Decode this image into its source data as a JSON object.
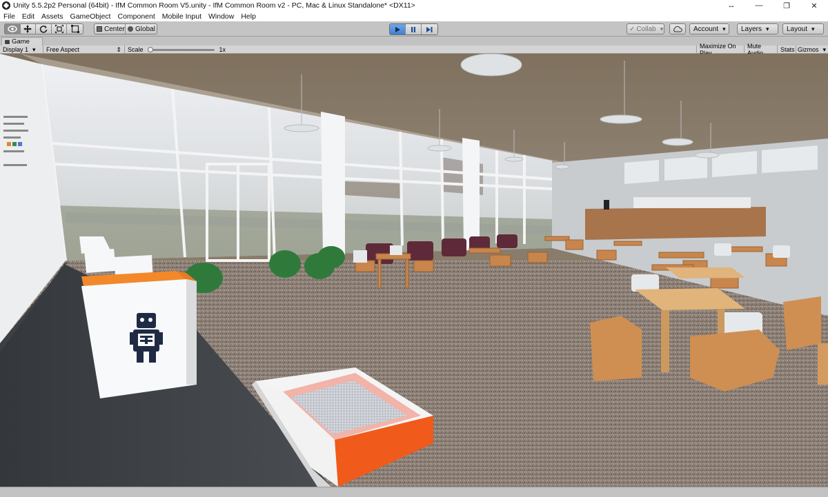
{
  "window": {
    "title": "Unity 5.5.2p2 Personal (64bit) - IfM Common Room V5.unity - IfM Common Room v2 - PC, Mac & Linux Standalone* <DX11>",
    "icon": "unity-icon",
    "controls": {
      "resize": "↔",
      "minimize": "—",
      "maximize": "❐",
      "close": "✕"
    }
  },
  "menu": [
    "File",
    "Edit",
    "Assets",
    "GameObject",
    "Component",
    "Mobile Input",
    "Window",
    "Help"
  ],
  "toolbar": {
    "tools": [
      "hand-tool",
      "move-tool",
      "rotate-tool",
      "scale-tool",
      "rect-tool"
    ],
    "pivot": "Center",
    "space": "Global",
    "collab": "Collab",
    "account": "Account",
    "layers": "Layers",
    "layout": "Layout"
  },
  "game": {
    "tab": "Game",
    "display": "Display 1",
    "aspect": "Free Aspect",
    "scale_label": "Scale",
    "scale_value": "1x",
    "scale_fraction": 0.0,
    "maximize": "Maximize On Play",
    "mute": "Mute Audio",
    "stats": "Stats",
    "gizmos": "Gizmos"
  },
  "colors": {
    "accent_play": "#3f7fcf",
    "orange": "#f08a2a",
    "tray_orange": "#f05a1a"
  }
}
